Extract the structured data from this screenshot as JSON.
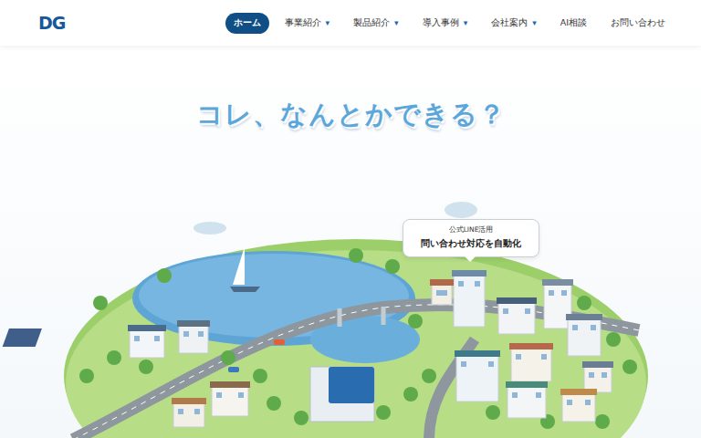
{
  "logo": "DG",
  "nav": [
    {
      "label": "ホーム",
      "selected": true,
      "dropdown": false
    },
    {
      "label": "事業紹介",
      "selected": false,
      "dropdown": true
    },
    {
      "label": "製品紹介",
      "selected": false,
      "dropdown": true
    },
    {
      "label": "導入事例",
      "selected": false,
      "dropdown": true
    },
    {
      "label": "会社案内",
      "selected": false,
      "dropdown": true
    },
    {
      "label": "AI相談",
      "selected": false,
      "dropdown": false
    },
    {
      "label": "お問い合わせ",
      "selected": false,
      "dropdown": false
    }
  ],
  "dropdown_icon": "▾",
  "hero": {
    "headline": "コレ、なんとかできる？"
  },
  "callout": {
    "label": "公式LINE活用",
    "title": "問い合わせ対応を自動化"
  }
}
